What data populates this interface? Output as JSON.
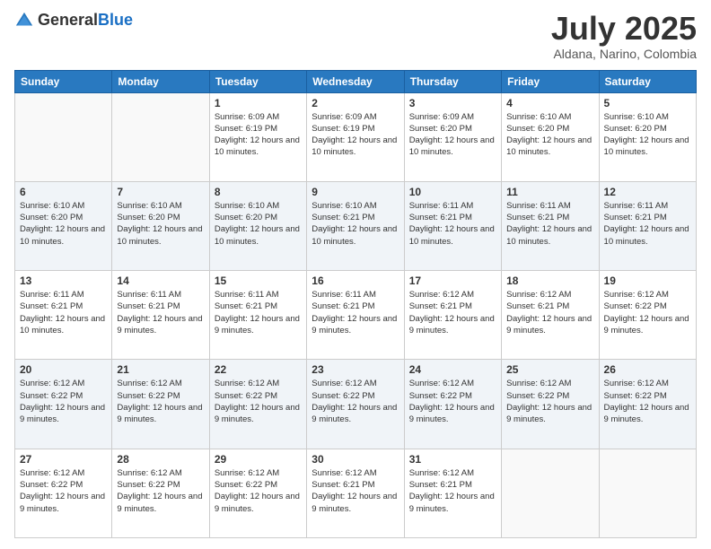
{
  "header": {
    "logo_general": "General",
    "logo_blue": "Blue",
    "month_title": "July 2025",
    "location": "Aldana, Narino, Colombia"
  },
  "weekdays": [
    "Sunday",
    "Monday",
    "Tuesday",
    "Wednesday",
    "Thursday",
    "Friday",
    "Saturday"
  ],
  "weeks": [
    [
      {
        "day": "",
        "sunrise": "",
        "sunset": "",
        "daylight": ""
      },
      {
        "day": "",
        "sunrise": "",
        "sunset": "",
        "daylight": ""
      },
      {
        "day": "1",
        "sunrise": "Sunrise: 6:09 AM",
        "sunset": "Sunset: 6:19 PM",
        "daylight": "Daylight: 12 hours and 10 minutes."
      },
      {
        "day": "2",
        "sunrise": "Sunrise: 6:09 AM",
        "sunset": "Sunset: 6:19 PM",
        "daylight": "Daylight: 12 hours and 10 minutes."
      },
      {
        "day": "3",
        "sunrise": "Sunrise: 6:09 AM",
        "sunset": "Sunset: 6:20 PM",
        "daylight": "Daylight: 12 hours and 10 minutes."
      },
      {
        "day": "4",
        "sunrise": "Sunrise: 6:10 AM",
        "sunset": "Sunset: 6:20 PM",
        "daylight": "Daylight: 12 hours and 10 minutes."
      },
      {
        "day": "5",
        "sunrise": "Sunrise: 6:10 AM",
        "sunset": "Sunset: 6:20 PM",
        "daylight": "Daylight: 12 hours and 10 minutes."
      }
    ],
    [
      {
        "day": "6",
        "sunrise": "Sunrise: 6:10 AM",
        "sunset": "Sunset: 6:20 PM",
        "daylight": "Daylight: 12 hours and 10 minutes."
      },
      {
        "day": "7",
        "sunrise": "Sunrise: 6:10 AM",
        "sunset": "Sunset: 6:20 PM",
        "daylight": "Daylight: 12 hours and 10 minutes."
      },
      {
        "day": "8",
        "sunrise": "Sunrise: 6:10 AM",
        "sunset": "Sunset: 6:20 PM",
        "daylight": "Daylight: 12 hours and 10 minutes."
      },
      {
        "day": "9",
        "sunrise": "Sunrise: 6:10 AM",
        "sunset": "Sunset: 6:21 PM",
        "daylight": "Daylight: 12 hours and 10 minutes."
      },
      {
        "day": "10",
        "sunrise": "Sunrise: 6:11 AM",
        "sunset": "Sunset: 6:21 PM",
        "daylight": "Daylight: 12 hours and 10 minutes."
      },
      {
        "day": "11",
        "sunrise": "Sunrise: 6:11 AM",
        "sunset": "Sunset: 6:21 PM",
        "daylight": "Daylight: 12 hours and 10 minutes."
      },
      {
        "day": "12",
        "sunrise": "Sunrise: 6:11 AM",
        "sunset": "Sunset: 6:21 PM",
        "daylight": "Daylight: 12 hours and 10 minutes."
      }
    ],
    [
      {
        "day": "13",
        "sunrise": "Sunrise: 6:11 AM",
        "sunset": "Sunset: 6:21 PM",
        "daylight": "Daylight: 12 hours and 10 minutes."
      },
      {
        "day": "14",
        "sunrise": "Sunrise: 6:11 AM",
        "sunset": "Sunset: 6:21 PM",
        "daylight": "Daylight: 12 hours and 9 minutes."
      },
      {
        "day": "15",
        "sunrise": "Sunrise: 6:11 AM",
        "sunset": "Sunset: 6:21 PM",
        "daylight": "Daylight: 12 hours and 9 minutes."
      },
      {
        "day": "16",
        "sunrise": "Sunrise: 6:11 AM",
        "sunset": "Sunset: 6:21 PM",
        "daylight": "Daylight: 12 hours and 9 minutes."
      },
      {
        "day": "17",
        "sunrise": "Sunrise: 6:12 AM",
        "sunset": "Sunset: 6:21 PM",
        "daylight": "Daylight: 12 hours and 9 minutes."
      },
      {
        "day": "18",
        "sunrise": "Sunrise: 6:12 AM",
        "sunset": "Sunset: 6:21 PM",
        "daylight": "Daylight: 12 hours and 9 minutes."
      },
      {
        "day": "19",
        "sunrise": "Sunrise: 6:12 AM",
        "sunset": "Sunset: 6:22 PM",
        "daylight": "Daylight: 12 hours and 9 minutes."
      }
    ],
    [
      {
        "day": "20",
        "sunrise": "Sunrise: 6:12 AM",
        "sunset": "Sunset: 6:22 PM",
        "daylight": "Daylight: 12 hours and 9 minutes."
      },
      {
        "day": "21",
        "sunrise": "Sunrise: 6:12 AM",
        "sunset": "Sunset: 6:22 PM",
        "daylight": "Daylight: 12 hours and 9 minutes."
      },
      {
        "day": "22",
        "sunrise": "Sunrise: 6:12 AM",
        "sunset": "Sunset: 6:22 PM",
        "daylight": "Daylight: 12 hours and 9 minutes."
      },
      {
        "day": "23",
        "sunrise": "Sunrise: 6:12 AM",
        "sunset": "Sunset: 6:22 PM",
        "daylight": "Daylight: 12 hours and 9 minutes."
      },
      {
        "day": "24",
        "sunrise": "Sunrise: 6:12 AM",
        "sunset": "Sunset: 6:22 PM",
        "daylight": "Daylight: 12 hours and 9 minutes."
      },
      {
        "day": "25",
        "sunrise": "Sunrise: 6:12 AM",
        "sunset": "Sunset: 6:22 PM",
        "daylight": "Daylight: 12 hours and 9 minutes."
      },
      {
        "day": "26",
        "sunrise": "Sunrise: 6:12 AM",
        "sunset": "Sunset: 6:22 PM",
        "daylight": "Daylight: 12 hours and 9 minutes."
      }
    ],
    [
      {
        "day": "27",
        "sunrise": "Sunrise: 6:12 AM",
        "sunset": "Sunset: 6:22 PM",
        "daylight": "Daylight: 12 hours and 9 minutes."
      },
      {
        "day": "28",
        "sunrise": "Sunrise: 6:12 AM",
        "sunset": "Sunset: 6:22 PM",
        "daylight": "Daylight: 12 hours and 9 minutes."
      },
      {
        "day": "29",
        "sunrise": "Sunrise: 6:12 AM",
        "sunset": "Sunset: 6:22 PM",
        "daylight": "Daylight: 12 hours and 9 minutes."
      },
      {
        "day": "30",
        "sunrise": "Sunrise: 6:12 AM",
        "sunset": "Sunset: 6:21 PM",
        "daylight": "Daylight: 12 hours and 9 minutes."
      },
      {
        "day": "31",
        "sunrise": "Sunrise: 6:12 AM",
        "sunset": "Sunset: 6:21 PM",
        "daylight": "Daylight: 12 hours and 9 minutes."
      },
      {
        "day": "",
        "sunrise": "",
        "sunset": "",
        "daylight": ""
      },
      {
        "day": "",
        "sunrise": "",
        "sunset": "",
        "daylight": ""
      }
    ]
  ]
}
